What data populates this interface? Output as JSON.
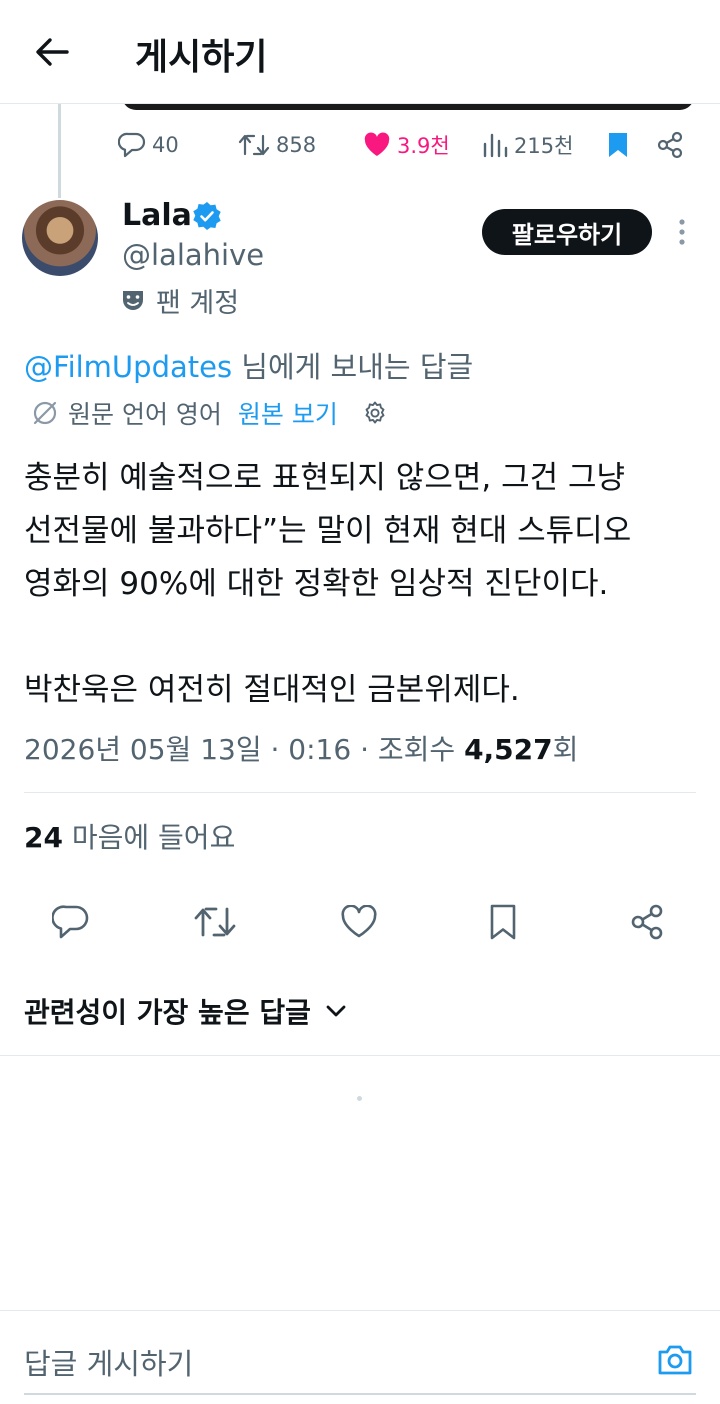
{
  "header": {
    "title": "게시하기",
    "back_icon": "arrow-left-icon"
  },
  "parent_tweet": {
    "replies": "40",
    "retweets": "858",
    "likes": "3.9천",
    "views": "215천",
    "liked": true,
    "bookmarked": true
  },
  "author": {
    "name": "Lala",
    "handle": "@lalahive",
    "badge": "verified",
    "account_label": "팬 계정",
    "follow_label": "팔로우하기"
  },
  "reply_context": {
    "mention": "@FilmUpdates",
    "suffix": " 님에게 보내는 답글"
  },
  "translation": {
    "label": "원문 언어 영어",
    "show_original": "원본 보기"
  },
  "tweet": {
    "lines": [
      "충분히 예술적으로 표현되지 않으면, 그건 그냥",
      "선전물에 불과하다”는 말이 현재 현대 스튜디오",
      "영화의 90%에 대한 정확한 임상적 진단이다.",
      "박찬욱은 여전히 절대적인 금본위제다."
    ],
    "date": "2026년 05월 13일 · 0:16 · 조회수 ",
    "views_count": "4,527",
    "views_suffix": "회"
  },
  "engagement": {
    "likes_count": "24",
    "likes_label": " 마음에 들어요"
  },
  "sort": {
    "label": "관련성이 가장 높은 답글"
  },
  "composer": {
    "placeholder": "답글 게시하기"
  },
  "colors": {
    "accent": "#1d9bf0",
    "like": "#f91880",
    "text": "#0f1419",
    "secondary": "#536471"
  }
}
